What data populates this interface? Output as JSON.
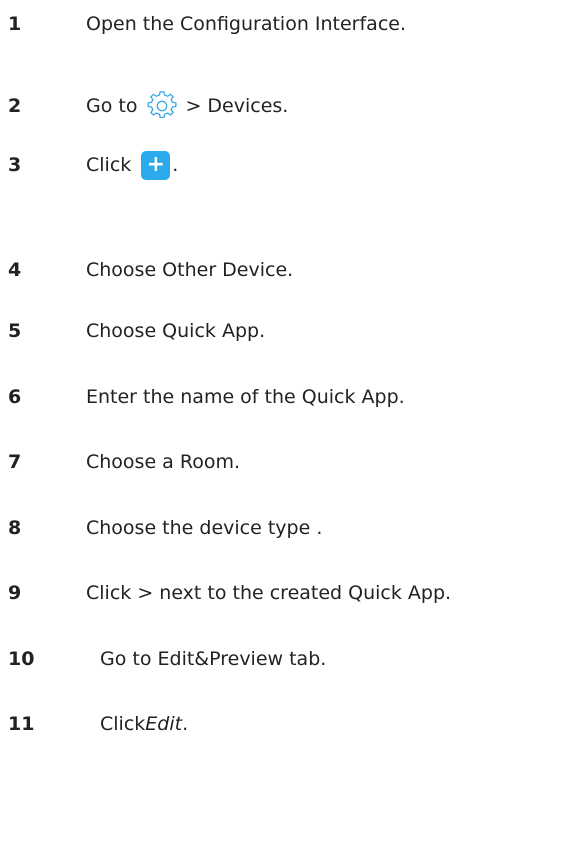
{
  "steps": [
    {
      "number": "1",
      "text": "Open the Configuration Interface."
    },
    {
      "number": "2",
      "text_before": "Go to",
      "icon": "gear-icon",
      "text_after": "> Devices."
    },
    {
      "number": "3",
      "text_before": "Click",
      "icon": "plus-icon",
      "icon_glyph": "+",
      "text_after": "."
    },
    {
      "number": "4",
      "text": "Choose Other Device."
    },
    {
      "number": "5",
      "text": "Choose Quick App."
    },
    {
      "number": "6",
      "text": "Enter the name of the Quick App."
    },
    {
      "number": "7",
      "text": "Choose a Room."
    },
    {
      "number": "8",
      "text": "Choose the device type ."
    },
    {
      "number": "9",
      "text": "Click > next to the created Quick App."
    },
    {
      "number": "10",
      "text": "Go to Edit&Preview tab."
    },
    {
      "number": "11",
      "text_before": "Click ",
      "emphasis": "Edit",
      "text_after": "."
    }
  ],
  "colors": {
    "text": "#222222",
    "accent": "#2aa9ec",
    "gear_stroke": "#35a8e4"
  }
}
